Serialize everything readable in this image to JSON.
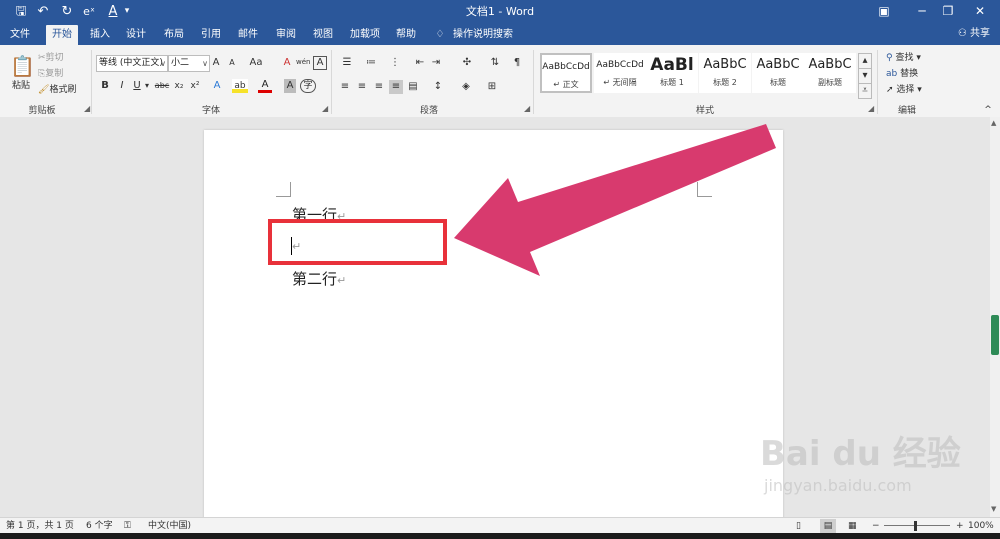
{
  "titlebar": {
    "doc_title": "文档1 - Word",
    "qa_save": "🖫",
    "qa_undo": "↶",
    "qa_redo": "↻",
    "qa_eq": "eˣ",
    "qa_font": "A"
  },
  "tabs": [
    {
      "label": "文件"
    },
    {
      "label": "开始"
    },
    {
      "label": "插入"
    },
    {
      "label": "设计"
    },
    {
      "label": "布局"
    },
    {
      "label": "引用"
    },
    {
      "label": "邮件"
    },
    {
      "label": "审阅"
    },
    {
      "label": "视图"
    },
    {
      "label": "帮助"
    },
    {
      "label": "加载项"
    },
    {
      "label": "操作说明搜索"
    }
  ],
  "share_label": "共享",
  "clipboard": {
    "paste": "粘贴",
    "cut": "剪切",
    "copy": "复制",
    "format_painter": "格式刷",
    "group_label": "剪贴板"
  },
  "font": {
    "font_name": "等线 (中文正文)",
    "font_size": "小二",
    "group_label": "字体",
    "grow": "A",
    "shrink": "A",
    "case": "Aa",
    "clear": "A",
    "phonetic": "wén",
    "border": "A",
    "bold": "B",
    "italic": "I",
    "underline": "U",
    "strike": "abc",
    "sub": "x₂",
    "sup": "x²",
    "effects": "A",
    "highlight": "ab",
    "color": "A",
    "shade": "A",
    "circle": "字"
  },
  "paragraph": {
    "group_label": "段落"
  },
  "styles": {
    "group_label": "样式",
    "items": [
      {
        "sample": "AaBbCcDd",
        "name": "正文"
      },
      {
        "sample": "AaBbCcDd",
        "name": "无间隔"
      },
      {
        "sample": "AaBl",
        "name": "标题 1"
      },
      {
        "sample": "AaBbC",
        "name": "标题 2"
      },
      {
        "sample": "AaBbC",
        "name": "标题"
      },
      {
        "sample": "AaBbC",
        "name": "副标题"
      }
    ]
  },
  "editing": {
    "find": "查找",
    "replace": "替换",
    "select": "选择",
    "group_label": "编辑"
  },
  "document": {
    "line1": "第一行",
    "line2": "",
    "line3": "第二行",
    "para_mark": "↵"
  },
  "status": {
    "page": "第 1 页，共 1 页",
    "words": "6 个字",
    "language": "中文(中国)",
    "zoom": "100%"
  },
  "watermark": {
    "brand": "Bai du 经验",
    "url": "jingyan.baidu.com"
  },
  "colors": {
    "word_blue": "#2b579a",
    "annotation_red": "#e8313a",
    "arrow_pink": "#d83a6e"
  }
}
